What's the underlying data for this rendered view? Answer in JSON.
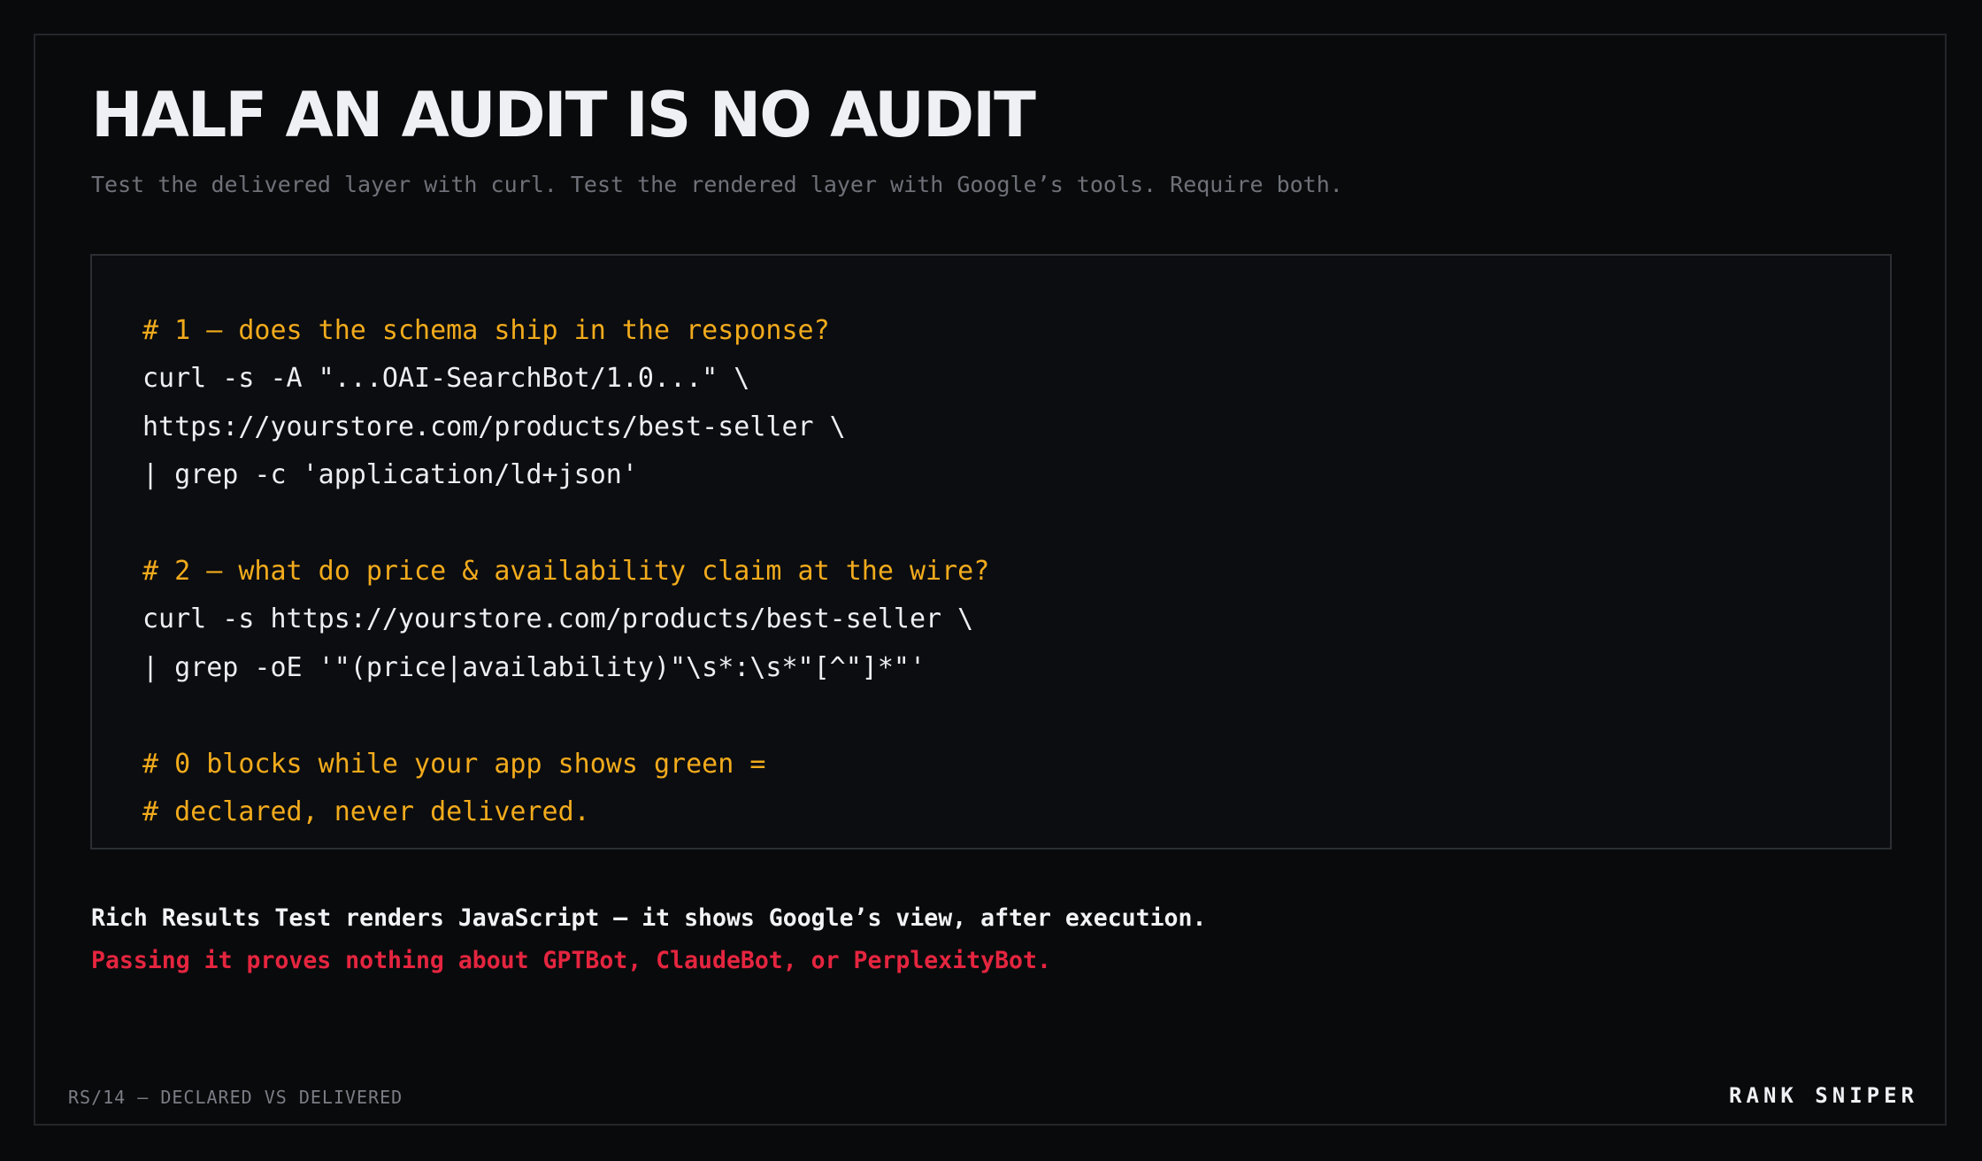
{
  "slide": {
    "title": "HALF AN AUDIT IS NO AUDIT",
    "subtitle": "Test the delivered layer with curl. Test the rendered layer with Google’s tools. Require both."
  },
  "code": {
    "lines": [
      {
        "text": "# 1 — does the schema ship in the response?",
        "kind": "comment"
      },
      {
        "text": "curl -s -A \"...OAI-SearchBot/1.0...\" \\",
        "kind": "command"
      },
      {
        "text": "https://yourstore.com/products/best-seller \\",
        "kind": "command"
      },
      {
        "text": "| grep -c 'application/ld+json'",
        "kind": "command"
      },
      {
        "text": "",
        "kind": "blank"
      },
      {
        "text": "# 2 — what do price & availability claim at the wire?",
        "kind": "comment"
      },
      {
        "text": "curl -s https://yourstore.com/products/best-seller \\",
        "kind": "command"
      },
      {
        "text": "| grep -oE '\"(price|availability)\"\\s*:\\s*\"[^\"]*\"'",
        "kind": "command"
      },
      {
        "text": "",
        "kind": "blank"
      },
      {
        "text": "# 0 blocks while your app shows green =",
        "kind": "comment"
      },
      {
        "text": "# declared, never delivered.",
        "kind": "comment"
      }
    ]
  },
  "notes": {
    "line1": "Rich Results Test renders JavaScript — it shows Google’s view, after execution.",
    "line2": "Passing it proves nothing about GPTBot, ClaudeBot, or PerplexityBot."
  },
  "footer": {
    "left": "RS/14 — DECLARED VS DELIVERED",
    "brand": "RANK SNIPER"
  },
  "colors": {
    "background": "#090a0c",
    "comment": "#f2ab1c",
    "warning": "#e5253f",
    "text": "#eceef2",
    "muted": "#6e7178"
  }
}
